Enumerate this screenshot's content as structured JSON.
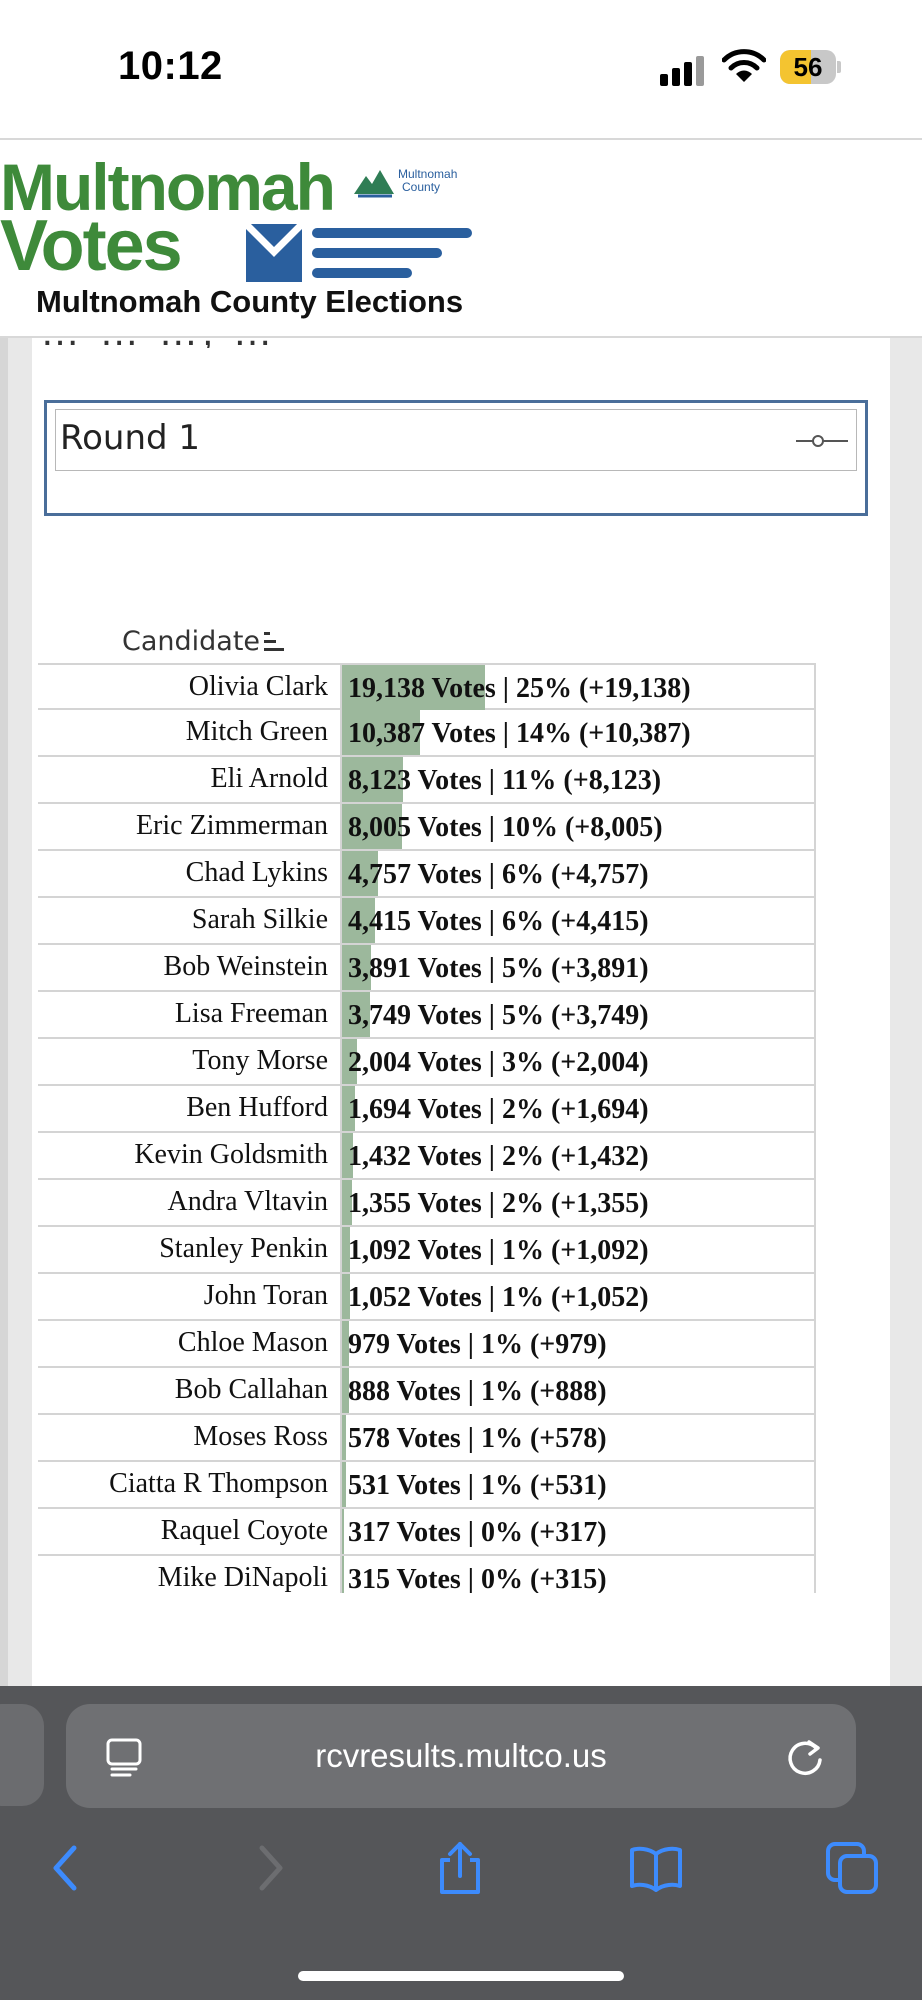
{
  "status_bar": {
    "time": "10:12",
    "battery_level": "56",
    "battery_fraction": 0.56,
    "icons": [
      "cellular-signal-icon",
      "wifi-icon",
      "battery-icon"
    ]
  },
  "header": {
    "logo_line1": "Multnomah",
    "logo_line2": "Votes",
    "county_mark_line1": "Multnomah",
    "county_mark_line2": "County",
    "org_name": "Multnomah County Elections",
    "partially_visible_text": "… … …, …"
  },
  "round_selector": {
    "selected": "Round 1",
    "icon": "slider-icon"
  },
  "results": {
    "column_header": "Candidate",
    "sort_icon": "sort-descending-icon",
    "bar_color": "#9cb89c",
    "max_votes": 19138,
    "rows": [
      {
        "name": "Olivia Clark",
        "votes": 19138,
        "label": "19,138 Votes | 25% (+19,138)"
      },
      {
        "name": "Mitch Green",
        "votes": 10387,
        "label": "10,387 Votes | 14% (+10,387)"
      },
      {
        "name": "Eli Arnold",
        "votes": 8123,
        "label": "8,123 Votes | 11% (+8,123)"
      },
      {
        "name": "Eric Zimmerman",
        "votes": 8005,
        "label": "8,005 Votes | 10% (+8,005)"
      },
      {
        "name": "Chad Lykins",
        "votes": 4757,
        "label": "4,757 Votes | 6% (+4,757)"
      },
      {
        "name": "Sarah Silkie",
        "votes": 4415,
        "label": "4,415 Votes | 6% (+4,415)"
      },
      {
        "name": "Bob Weinstein",
        "votes": 3891,
        "label": "3,891 Votes | 5% (+3,891)"
      },
      {
        "name": "Lisa Freeman",
        "votes": 3749,
        "label": "3,749 Votes | 5% (+3,749)"
      },
      {
        "name": "Tony Morse",
        "votes": 2004,
        "label": "2,004 Votes | 3% (+2,004)"
      },
      {
        "name": "Ben Hufford",
        "votes": 1694,
        "label": "1,694 Votes | 2% (+1,694)"
      },
      {
        "name": "Kevin Goldsmith",
        "votes": 1432,
        "label": "1,432 Votes | 2% (+1,432)"
      },
      {
        "name": "Andra Vltavin",
        "votes": 1355,
        "label": "1,355 Votes | 2% (+1,355)"
      },
      {
        "name": "Stanley Penkin",
        "votes": 1092,
        "label": "1,092 Votes | 1% (+1,092)"
      },
      {
        "name": "John Toran",
        "votes": 1052,
        "label": "1,052 Votes | 1% (+1,052)"
      },
      {
        "name": "Chloe Mason",
        "votes": 979,
        "label": "979 Votes | 1% (+979)"
      },
      {
        "name": "Bob Callahan",
        "votes": 888,
        "label": "888 Votes | 1% (+888)"
      },
      {
        "name": "Moses Ross",
        "votes": 578,
        "label": "578 Votes | 1% (+578)"
      },
      {
        "name": "Ciatta R Thompson",
        "votes": 531,
        "label": "531 Votes | 1% (+531)"
      },
      {
        "name": "Raquel Coyote",
        "votes": 317,
        "label": "317 Votes | 0% (+317)"
      },
      {
        "name": "Mike DiNapoli",
        "votes": 315,
        "label": "315 Votes | 0% (+315)"
      }
    ]
  },
  "browser": {
    "url": "rcvresults.multco.us",
    "toolbar_icons": [
      "back-icon",
      "forward-icon",
      "share-icon",
      "bookmarks-icon",
      "tabs-icon"
    ],
    "accent_color": "#3d8bfd"
  }
}
